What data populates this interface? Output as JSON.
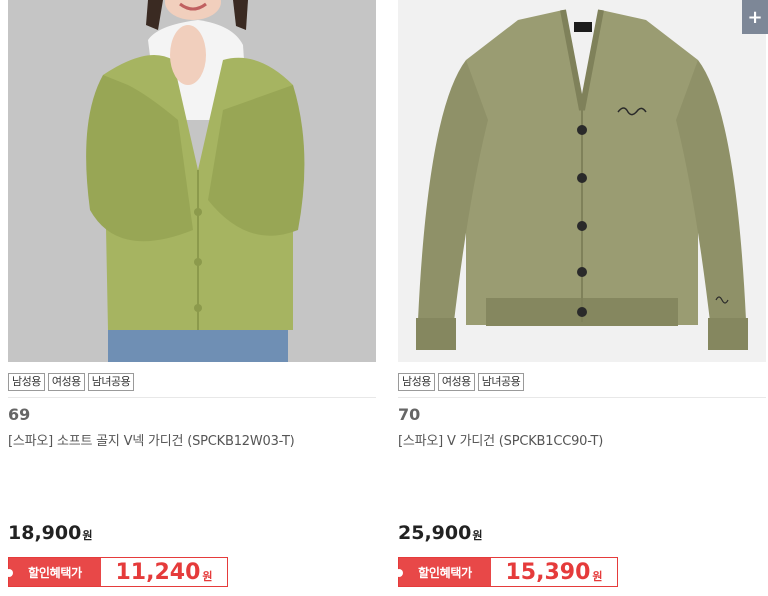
{
  "products": [
    {
      "tags": [
        "남성용",
        "여성용",
        "남녀공용"
      ],
      "number": "69",
      "name": "[스파오] 소프트 골지 V넥 가디건 (SPCKB12W03-T)",
      "price": "18,900",
      "price_unit": "원",
      "discount_label": "할인혜택가",
      "discount_price": "11,240",
      "discount_unit": "원",
      "image": "model-wearing-green-cardigan"
    },
    {
      "tags": [
        "남성용",
        "여성용",
        "남녀공용"
      ],
      "number": "70",
      "name": "[스파오] V 가디건 (SPCKB1CC90-T)",
      "price": "25,900",
      "price_unit": "원",
      "discount_label": "할인혜택가",
      "discount_price": "15,390",
      "discount_unit": "원",
      "image": "khaki-cardigan-flat"
    }
  ],
  "plus_button": "+",
  "colors": {
    "accent_red": "#e53b3b",
    "tag_border": "#9a9a9a",
    "plus_bg": "#7d8797"
  }
}
